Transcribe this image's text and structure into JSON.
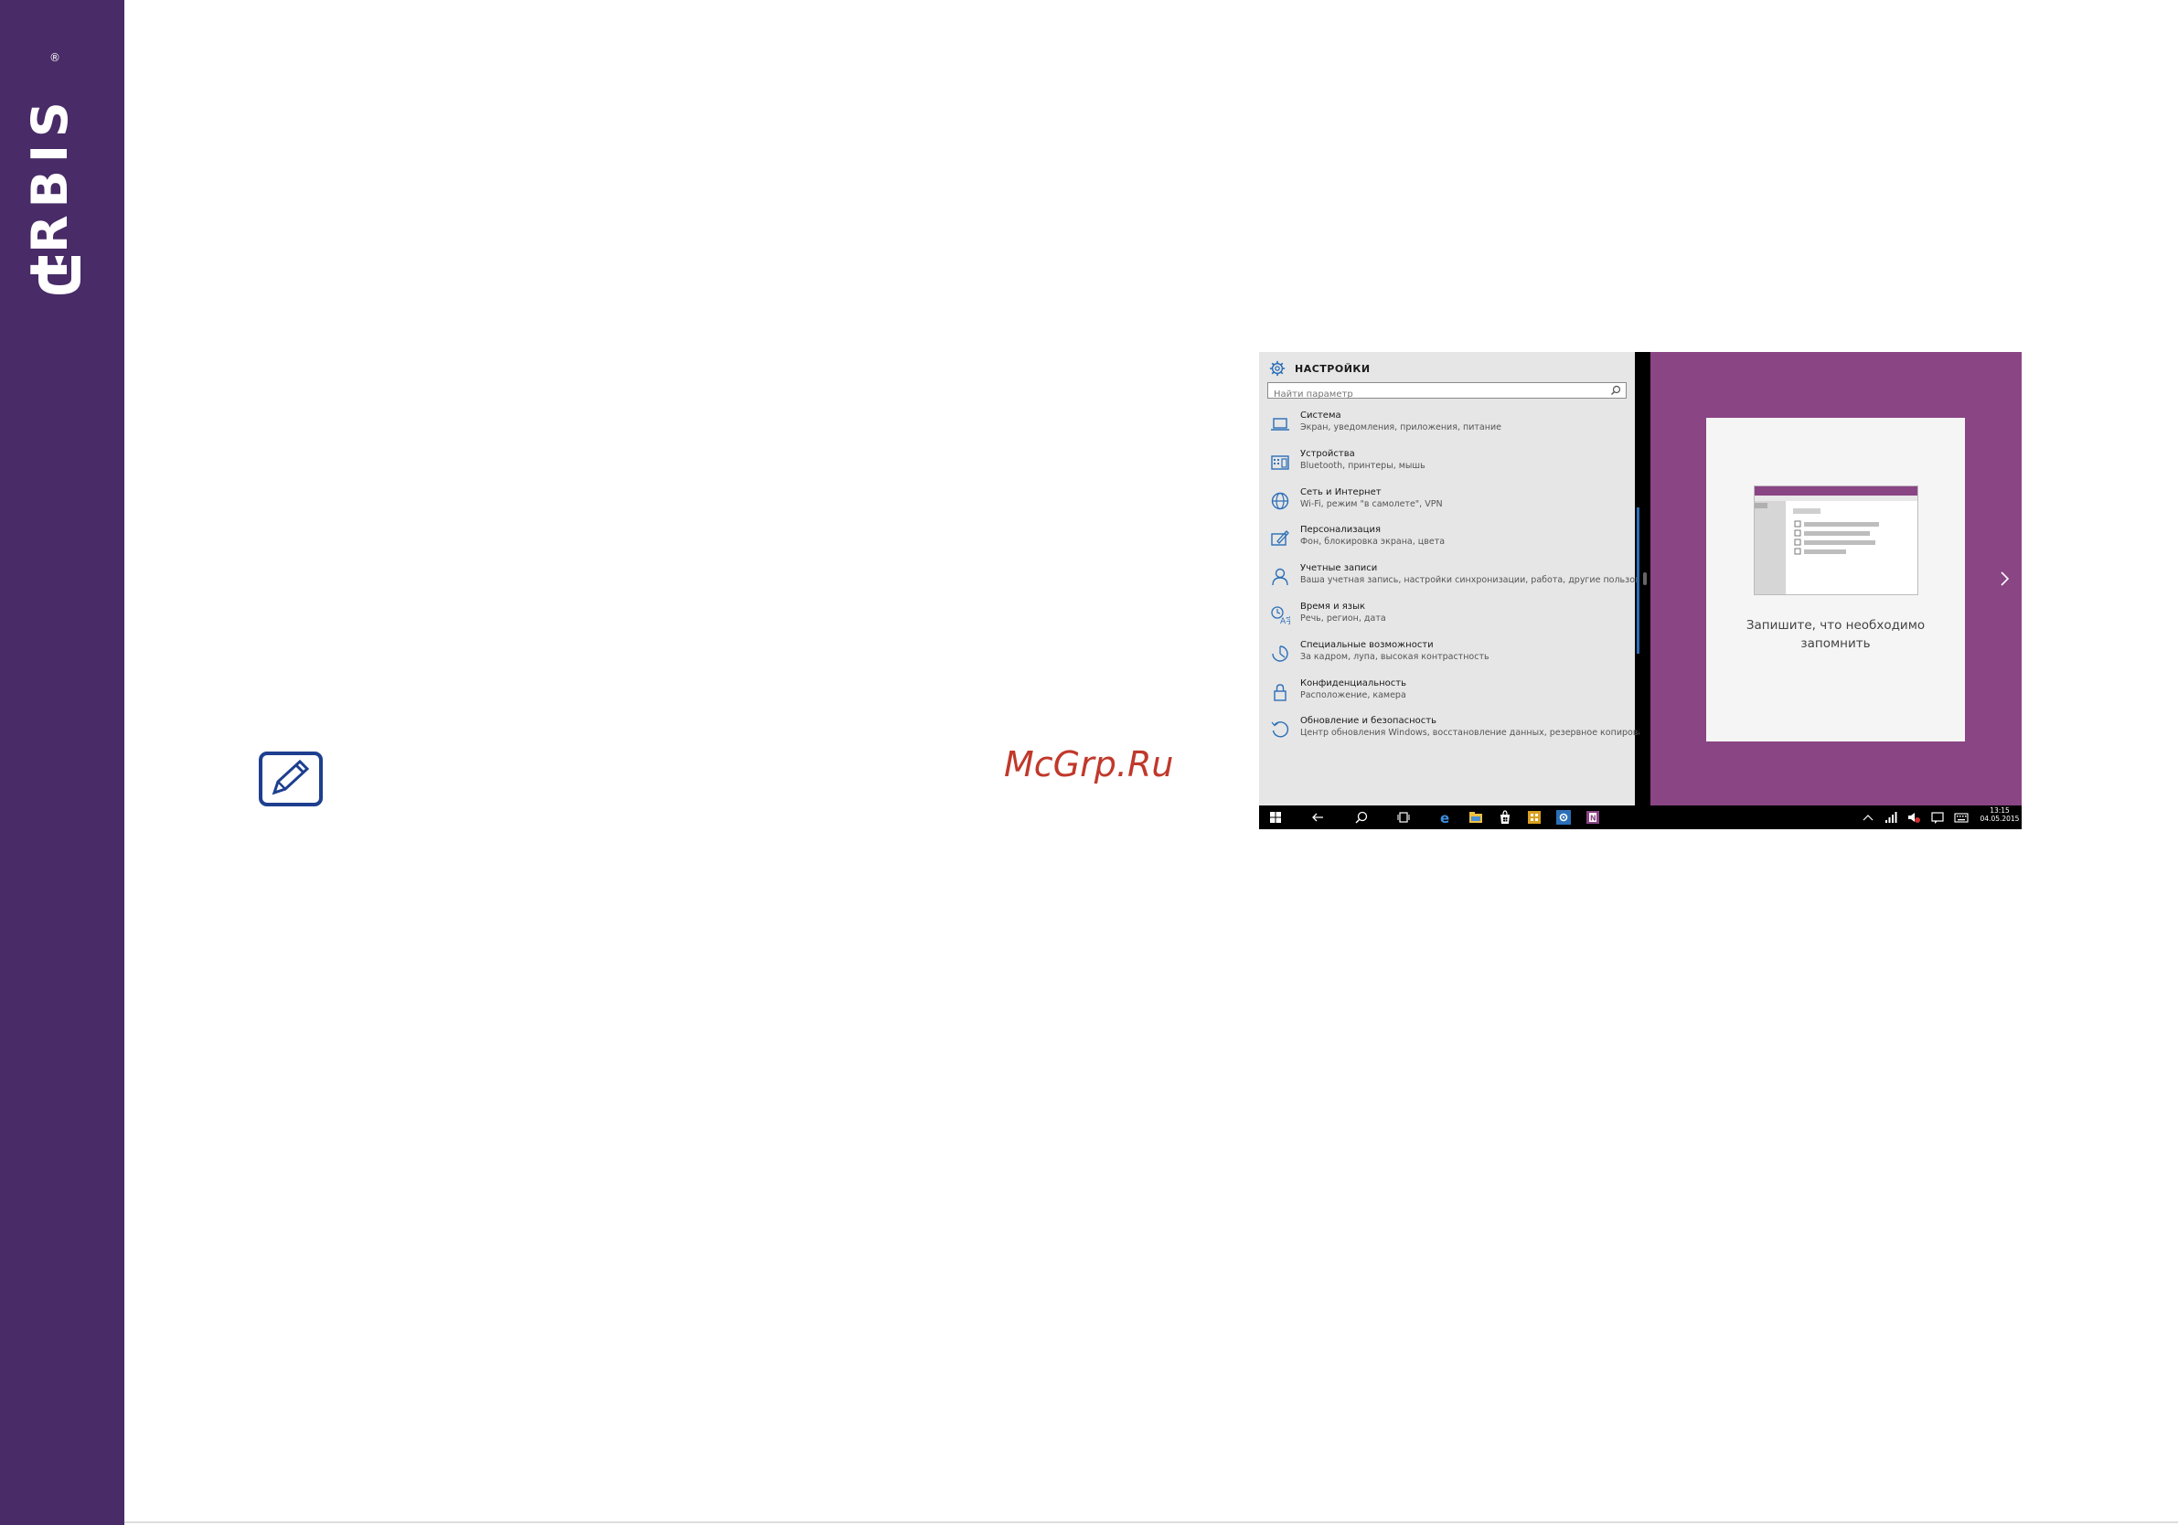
{
  "brand": {
    "logo_text": "IRBIS",
    "registered_mark": "®"
  },
  "watermark": "McGrp.Ru",
  "settings": {
    "title": "НАСТРОЙКИ",
    "search_placeholder": "Найти параметр",
    "categories": [
      {
        "title": "Система",
        "desc": "Экран, уведомления, приложения, питание",
        "icon": "laptop-icon"
      },
      {
        "title": "Устройства",
        "desc": "Bluetooth, принтеры, мышь",
        "icon": "devices-icon"
      },
      {
        "title": "Сеть и Интернет",
        "desc": "Wi-Fi, режим \"в самолете\", VPN",
        "icon": "globe-icon"
      },
      {
        "title": "Персонализация",
        "desc": "Фон, блокировка экрана, цвета",
        "icon": "personalization-icon"
      },
      {
        "title": "Учетные записи",
        "desc": "Ваша учетная запись, настройки синхронизации, работа, другие пользователи",
        "icon": "person-icon"
      },
      {
        "title": "Время и язык",
        "desc": "Речь, регион, дата",
        "icon": "time-language-icon"
      },
      {
        "title": "Специальные возможности",
        "desc": "За кадром, лупа, высокая контрастность",
        "icon": "accessibility-icon"
      },
      {
        "title": "Конфиденциальность",
        "desc": "Расположение, камера",
        "icon": "lock-icon"
      },
      {
        "title": "Обновление и безопасность",
        "desc": "Центр обновления Windows, восстановление данных, резервное копирование",
        "icon": "update-icon"
      }
    ]
  },
  "onenote": {
    "message": "Запишите, что необходимо запомнить"
  },
  "taskbar": {
    "time": "13:15",
    "date": "04.05.2015"
  },
  "colors": {
    "sidebar": "#482b67",
    "onenote_purple": "#8a4585",
    "accent_blue": "#2b6fb8",
    "watermark_red": "#c0392b"
  }
}
